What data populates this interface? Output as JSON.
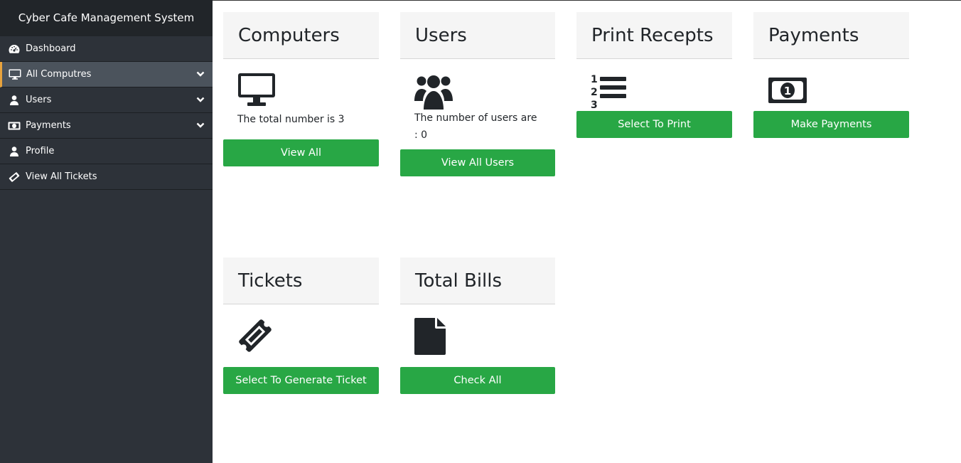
{
  "app": {
    "title": "Cyber Cafe Management System"
  },
  "sidebar": {
    "items": [
      {
        "label": "Dashboard",
        "icon": "tachometer-icon"
      },
      {
        "label": "All Computres",
        "icon": "desktop-icon",
        "active": true,
        "has_submenu": true
      },
      {
        "label": "Users",
        "icon": "user-icon",
        "has_submenu": true
      },
      {
        "label": "Payments",
        "icon": "money-bill-icon",
        "has_submenu": true
      },
      {
        "label": "Profile",
        "icon": "user-icon"
      },
      {
        "label": "View All Tickets",
        "icon": "ticket-icon"
      }
    ]
  },
  "cards": {
    "computers": {
      "title": "Computers",
      "icon": "desktop-icon",
      "text": "The total number is 3",
      "button": "View All"
    },
    "users": {
      "title": "Users",
      "icon": "users-icon",
      "text": "The number of users are : 0",
      "button": "View All Users"
    },
    "print": {
      "title": "Print Recepts",
      "icon": "list-ol-icon",
      "button": "Select To Print"
    },
    "payments": {
      "title": "Payments",
      "icon": "money-bill-icon",
      "button": "Make Payments"
    },
    "tickets": {
      "title": "Tickets",
      "icon": "ticket-icon",
      "button": "Select To Generate Ticket"
    },
    "bills": {
      "title": "Total Bills",
      "icon": "file-icon",
      "button": "Check All"
    }
  },
  "colors": {
    "sidebar": "#2d3239",
    "brand_bar": "#212529",
    "active_item": "#4b535c",
    "active_accent": "#e8a33d",
    "button": "#28a745"
  }
}
